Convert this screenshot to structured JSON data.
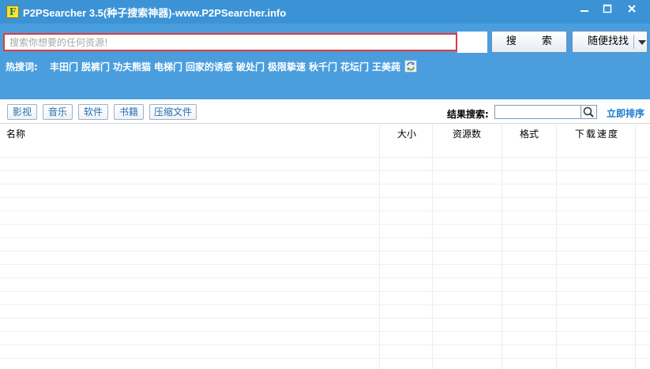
{
  "window": {
    "title": "P2PSearcher 3.5(种子搜索神器)-www.P2PSearcher.info",
    "app_icon_letter": "F",
    "buttons": [
      "minimize",
      "maximize",
      "close"
    ]
  },
  "search": {
    "placeholder": "搜索你想要的任何资源!",
    "value": "",
    "search_button": "搜 索",
    "random_button": "随便找找"
  },
  "hot": {
    "label": "热搜词:",
    "terms": [
      "丰田门",
      "脱裤门",
      "功夫熊猫",
      "电梯门",
      "回家的诱惑",
      "破处门",
      "极限挚速",
      "秋千门",
      "花坛门",
      "王美莼"
    ],
    "refresh_icon": "refresh-icon"
  },
  "categories": [
    "影视",
    "音乐",
    "软件",
    "书籍",
    "压缩文件"
  ],
  "result_search": {
    "label": "结果搜索:",
    "value": "",
    "go_icon": "magnifier-icon",
    "sort_label": "立即排序"
  },
  "table": {
    "columns": [
      "名称",
      "大小",
      "资源数",
      "格式",
      "下载速度"
    ],
    "rows": []
  },
  "colors": {
    "title_bar": "#3b93d6",
    "toolbar": "#4a9ede",
    "search_border": "#e03a3a",
    "link_blue": "#1a7ad0"
  }
}
